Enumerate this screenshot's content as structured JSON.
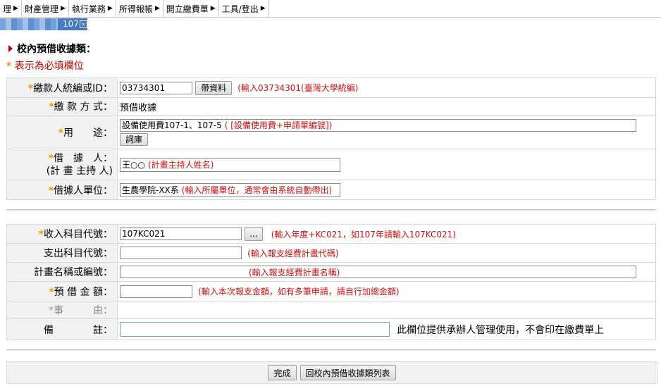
{
  "menu": [
    {
      "label": "理"
    },
    {
      "label": "財產管理"
    },
    {
      "label": "執行業務"
    },
    {
      "label": "所得報帳"
    },
    {
      "label": "開立繳費單"
    },
    {
      "label": "工具/登出"
    }
  ],
  "tab": {
    "label": "107"
  },
  "page_title": "校內預借收據類：",
  "required_note": "表示為必填欄位",
  "section1": {
    "payer_id": {
      "label": "繳款人統編或ID：",
      "value": "03734301",
      "button": "帶資料",
      "hint": "(輸入03734301(臺灣大學統編)"
    },
    "pay_method": {
      "label": "繳 款 方 式：",
      "value": "預借收據"
    },
    "purpose": {
      "label": "用　　途：",
      "value": "設備使用費107-1、107-5",
      "hint": "( [設備使用費+申請單編號])",
      "button": "詞庫"
    },
    "borrower": {
      "label_line1": "借　據　人：",
      "label_line2": "(計 畫 主持 人)",
      "value": "王○○",
      "hint": "(計畫主持人姓名)"
    },
    "borrower_unit": {
      "label": "借據人單位：",
      "value": "生農學院-XX系",
      "hint": "(輸入所屬單位，通常會由系統自動帶出)"
    }
  },
  "section2": {
    "income_code": {
      "label": "收入科目代號：",
      "value": "107KC021",
      "button": "...",
      "hint": "(輸入年度+KC021，如107年請輸入107KC021)"
    },
    "expense_code": {
      "label": "支出科目代號：",
      "value": "",
      "hint": "(輸入報支經費計畫代碼)"
    },
    "project_name": {
      "label": "計畫名稱或編號：",
      "value": "",
      "hint": "(輸入報支經費計畫名稱)"
    },
    "amount": {
      "label": "預 借 金 額：",
      "value": "",
      "hint": "(輸入本次報支金額，如有多筆申請，請自行加總金額)"
    },
    "reason": {
      "label": "事　　　由："
    },
    "remark": {
      "label": "備　　　　註：",
      "value": "",
      "hint": "此欄位提供承辦人管理使用，不會印在繳費單上"
    }
  },
  "buttons": {
    "done": "完成",
    "back": "回校內預借收據類列表"
  },
  "colors": {
    "required_star": "#e0a000",
    "hint_red": "#d01010",
    "title_triangle": "#c00000",
    "label_bg": "#f2f2f2"
  }
}
